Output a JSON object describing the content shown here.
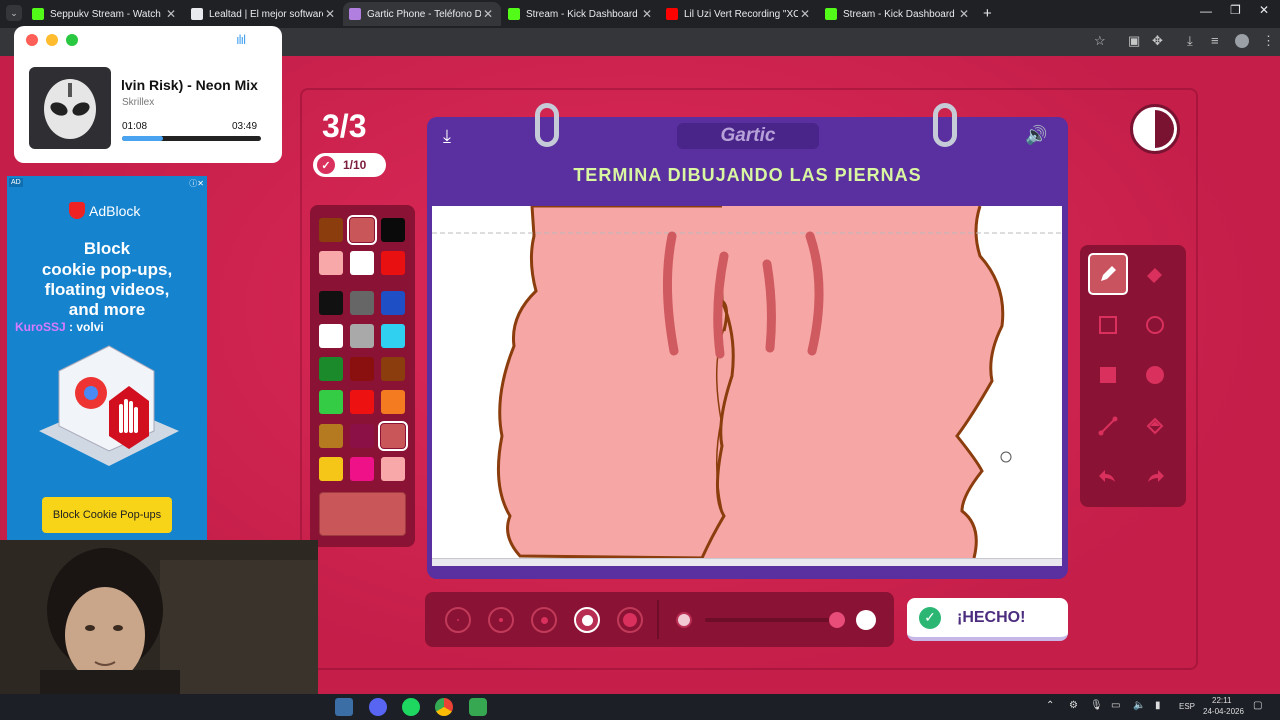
{
  "browser": {
    "tabs": [
      {
        "title": "Seppukv Stream - Watch Live o",
        "favicon_color": "#53fc18",
        "active": false
      },
      {
        "title": "Lealtad | El mejor software para",
        "favicon_color": "#e8eaed",
        "active": false
      },
      {
        "title": "Gartic Phone - Teléfono Desco",
        "favicon_color": "#b07fe0",
        "active": true
      },
      {
        "title": "Stream - Kick Dashboard",
        "favicon_color": "#53fc18",
        "active": false
      },
      {
        "title": "Lil Uzi Vert Recording \"XO Tour",
        "favicon_color": "#ff0000",
        "active": false
      },
      {
        "title": "Stream - Kick Dashboard",
        "favicon_color": "#53fc18",
        "active": false
      }
    ],
    "new_tab_label": "+"
  },
  "game": {
    "round": "3/3",
    "progress": "1/10",
    "instruction": "TERMINA DIBUJANDO LAS PIERNAS",
    "logo": "Gartic",
    "done_label": "¡HECHO!",
    "palette_colors": [
      "#8b3d0d",
      "#c9575a",
      "#0a0a0a",
      "#f8a8a8",
      "#ffffff",
      "#e81010",
      "#111111",
      "#666666",
      "#1f4fc4",
      "#ffffff",
      "#a9a9a9",
      "#2fd0f0",
      "#1a8a2a",
      "#8a0f0f",
      "#8b3d0d",
      "#33cc44",
      "#ee1111",
      "#f47b20",
      "#b57a20",
      "#8a1045",
      "#c9575a",
      "#f5c518",
      "#ee1188",
      "#f8a8a8"
    ],
    "selected_color": "#c9575a",
    "selected_color_index": 1,
    "selected_palette_index": 20,
    "active_tool": "pencil",
    "active_brush_size_index": 3,
    "opacity_percent": 100,
    "accent": "#d9305d",
    "board": "#5a2fa0"
  },
  "music": {
    "title": "lvin Risk) - Neon Mix",
    "artist": "Skrillex",
    "elapsed": "01:08",
    "duration": "03:49",
    "progress_percent": 29.7
  },
  "ad": {
    "tag": "AD",
    "brand": "AdBlock",
    "headline": [
      "Block",
      "cookie pop-ups,",
      "floating videos,",
      "and more"
    ],
    "cta": "Block Cookie Pop-ups"
  },
  "chat": {
    "user": "KuroSSJ",
    "message": ": volvi"
  },
  "taskbar": {
    "lang": "ESP",
    "time": "22:11",
    "date": "24-04-2026"
  }
}
